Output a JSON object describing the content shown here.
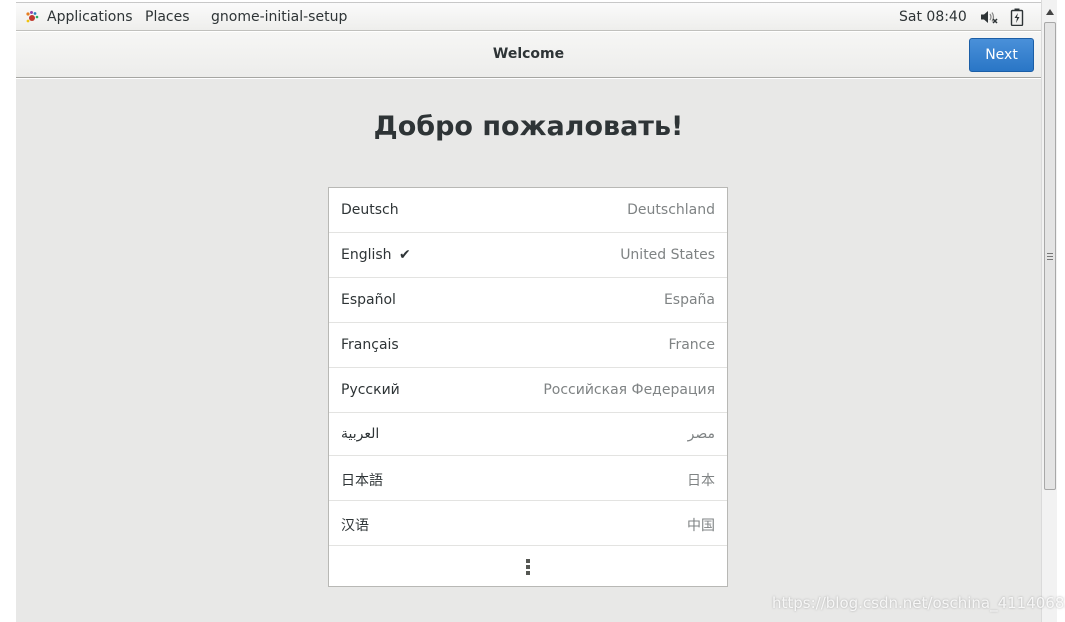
{
  "top_bar": {
    "applications_label": "Applications",
    "places_label": "Places",
    "app_name": "gnome-initial-setup",
    "clock": "Sat 08:40"
  },
  "header": {
    "title": "Welcome",
    "next_label": "Next"
  },
  "content": {
    "heading": "Добро пожаловать!",
    "languages": [
      {
        "name": "Deutsch",
        "region": "Deutschland",
        "selected": false
      },
      {
        "name": "English",
        "region": "United States",
        "selected": true
      },
      {
        "name": "Español",
        "region": "España",
        "selected": false
      },
      {
        "name": "Français",
        "region": "France",
        "selected": false
      },
      {
        "name": "Русский",
        "region": "Российская Федерация",
        "selected": false
      },
      {
        "name": "العربية",
        "region": "مصر",
        "selected": false
      },
      {
        "name": "日本語",
        "region": "日本",
        "selected": false
      },
      {
        "name": "汉语",
        "region": "中国",
        "selected": false
      }
    ],
    "check_mark": "✔"
  },
  "watermark": "https://blog.csdn.net/oschina_41140683",
  "colors": {
    "accent": "#3584e4",
    "background": "#e8e8e7"
  },
  "icons": {
    "apps": "gnome-foot-icon",
    "volume": "volume-muted-icon",
    "battery": "battery-icon",
    "more": "more-vertical-icon",
    "check": "check-icon"
  }
}
